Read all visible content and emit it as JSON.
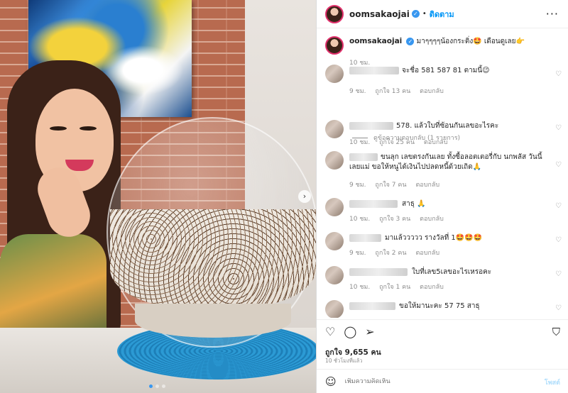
{
  "post": {
    "username": "oomsakaojai",
    "follow_label": "ติดตาม",
    "caption_text": "มาๆๆๆๆน้องกระติ่ง🤩 เดือนดูเลย👉",
    "caption_time": "10 ชม."
  },
  "comments": [
    {
      "text": "จะชื่อ 581 587 81 ตามนี้😉",
      "time": "9 ชม.",
      "likes": "ถูกใจ 13 คน",
      "reply": "ตอบกลับ"
    },
    {
      "text": "578. แล้วใบที่ซ้อนกันเลขอะไรคะ",
      "time": "10 ชม.",
      "likes": "ถูกใจ 25 คน",
      "reply": "ตอบกลับ"
    },
    {
      "text": "ขนลุก เลขตรงกันเลย ทั้งซื้อลอตเตอรี่กับ นกพลัส วันนี้ เลยแม่ ขอให้หนูได้เงินไปปลดหนี้ด้วยเถิด🙏",
      "time": "9 ชม.",
      "likes": "ถูกใจ 7 คน",
      "reply": "ตอบกลับ"
    },
    {
      "text": "สาธุ 🙏",
      "time": "10 ชม.",
      "likes": "ถูกใจ 3 คน",
      "reply": "ตอบกลับ"
    },
    {
      "text": "มาแล้ววววว รางวัลที่ 1🤩🤩🤩",
      "time": "9 ชม.",
      "likes": "ถูกใจ 2 คน",
      "reply": "ตอบกลับ"
    },
    {
      "text": "ใบที่เลข5เลขอะไรเหรอคะ",
      "time": "10 ชม.",
      "likes": "ถูกใจ 1 คน",
      "reply": "ตอบกลับ"
    },
    {
      "text": "ขอให้มานะคะ 57 75 สาธุ",
      "time": "",
      "likes": "",
      "reply": ""
    }
  ],
  "view_replies": "ดูข้อความตอบกลับ (1 รายการ)",
  "likes_count": "ถูกใจ 9,655 คน",
  "posted_ago": "10 ชั่วโมงที่แล้ว",
  "add_comment_placeholder": "เพิ่มความคิดเห็น",
  "post_button": "โพสต์",
  "icons": {
    "more": "more-icon",
    "heart": "heart-icon",
    "comment": "comment-icon",
    "share": "share-icon",
    "save": "bookmark-icon",
    "emoji": "emoji-icon",
    "verified": "verified-badge-icon",
    "next": "chevron-right-icon"
  },
  "colors": {
    "accent": "#0095f6",
    "verified": "#3897f0"
  }
}
